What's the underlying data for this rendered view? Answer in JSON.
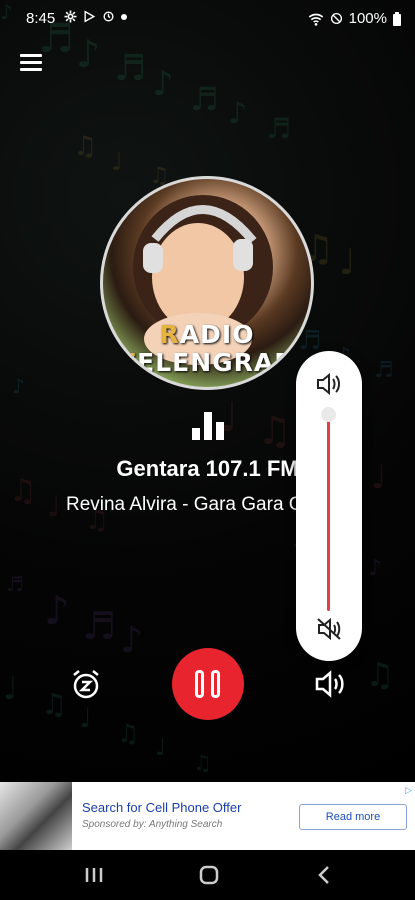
{
  "status_bar": {
    "time": "8:45",
    "battery": "100%",
    "left_icons": [
      "gear-icon",
      "play-store-icon",
      "sync-icon",
      "dot-icon"
    ],
    "right_icons": [
      "wifi-icon",
      "dnd-icon",
      "battery-icon"
    ]
  },
  "player": {
    "cover_text_line1": "RADIO",
    "cover_text_line2": "ZELENGRAD",
    "station_name": "Gentara 107.1 FM",
    "song": "Revina Alvira - Gara Gara Cendol",
    "state": "playing",
    "volume_level": 1.0
  },
  "ad": {
    "title": "Search for Cell Phone Offer",
    "sponsored": "Sponsored by: Anything Search",
    "cta": "Read more"
  },
  "colors": {
    "accent": "#e8252e",
    "background": "#000000",
    "panel": "#ffffff",
    "ad_link": "#1a3fa8"
  }
}
